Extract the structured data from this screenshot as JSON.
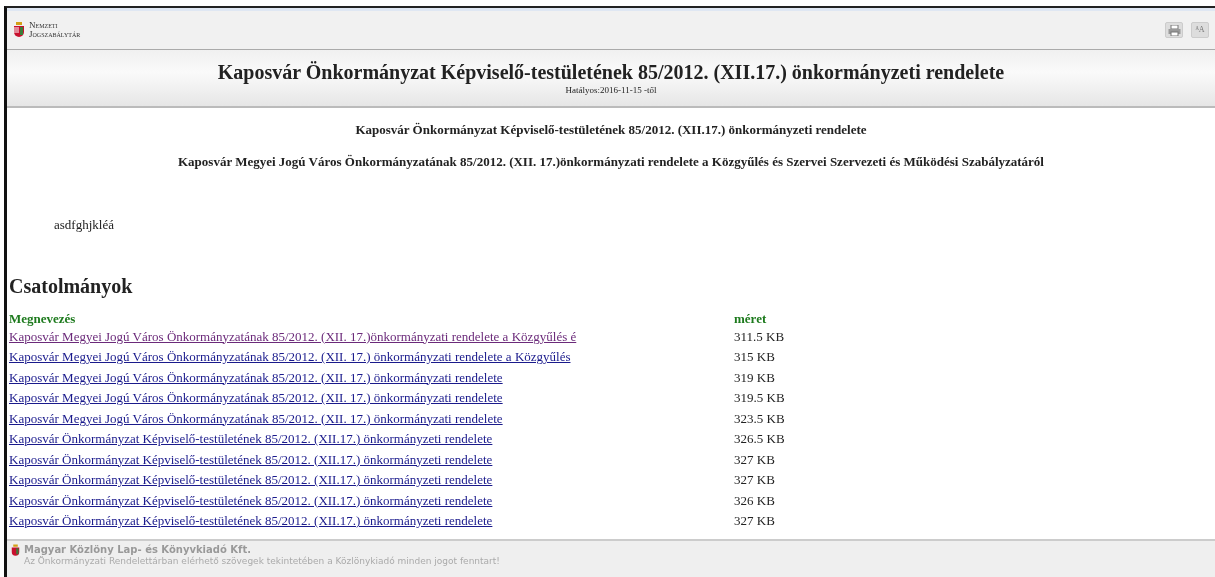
{
  "header": {
    "logo_lines": [
      "Nemzeti",
      "Jogszabálytár"
    ],
    "font_button": "ᴬA"
  },
  "title_band": {
    "title": "Kaposvár Önkormányzat Képviselő-testületének 85/2012. (XII.17.) önkormányzeti rendelete",
    "validity": "Hatályos:2016-11-15 -től"
  },
  "document": {
    "heading": "Kaposvár Önkormányzat Képviselő-testületének 85/2012. (XII.17.) önkormányzeti rendelete",
    "subheading": "Kaposvár Megyei Jogú Város Önkormányzatának 85/2012. (XII. 17.)önkormányzati rendelete a Közgyűlés és Szervei Szervezeti és Működési Szabályzatáról",
    "body": "asdfghjkléá"
  },
  "attachments": {
    "title": "Csatolmányok",
    "columns": [
      "Megnevezés",
      "méret"
    ],
    "rows": [
      {
        "name": "Kaposvár Megyei Jogú Város Önkormányzatának 85/2012. (XII. 17.)önkormányzati rendelete a Közgyűlés é",
        "size": "311.5 KB",
        "visited": true
      },
      {
        "name": "Kaposvár Megyei Jogú Város Önkormányzatának 85/2012. (XII. 17.) önkormányzati rendelete a Közgyűlés",
        "size": "315 KB",
        "visited": false
      },
      {
        "name": "Kaposvár Megyei Jogú Város Önkormányzatának 85/2012. (XII. 17.) önkormányzati rendelete",
        "size": "319 KB",
        "visited": false
      },
      {
        "name": "Kaposvár Megyei Jogú Város Önkormányzatának 85/2012. (XII. 17.) önkormányzati rendelete",
        "size": "319.5 KB",
        "visited": false
      },
      {
        "name": "Kaposvár Megyei Jogú Város Önkormányzatának 85/2012. (XII. 17.) önkormányzati rendelete",
        "size": "323.5 KB",
        "visited": false
      },
      {
        "name": "Kaposvár Önkormányzat Képviselő-testületének 85/2012. (XII.17.) önkormányzeti rendelete",
        "size": "326.5 KB",
        "visited": false
      },
      {
        "name": "Kaposvár Önkormányzat Képviselő-testületének 85/2012. (XII.17.) önkormányzeti rendelete",
        "size": "327 KB",
        "visited": false
      },
      {
        "name": "Kaposvár Önkormányzat Képviselő-testületének 85/2012. (XII.17.) önkormányzeti rendelete",
        "size": "327 KB",
        "visited": false
      },
      {
        "name": "Kaposvár Önkormányzat Képviselő-testületének 85/2012. (XII.17.) önkormányzeti rendelete",
        "size": "326 KB",
        "visited": false
      },
      {
        "name": "Kaposvár Önkormányzat Képviselő-testületének 85/2012. (XII.17.) önkormányzeti rendelete",
        "size": "327 KB",
        "visited": false
      }
    ]
  },
  "footer": {
    "company": "Magyar Közlöny Lap- és Könyvkiadó Kft.",
    "notice": "Az Önkormányzati Rendelettárban elérhető szövegek tekintetében a Közlönykiadó minden jogot fenntart!"
  }
}
